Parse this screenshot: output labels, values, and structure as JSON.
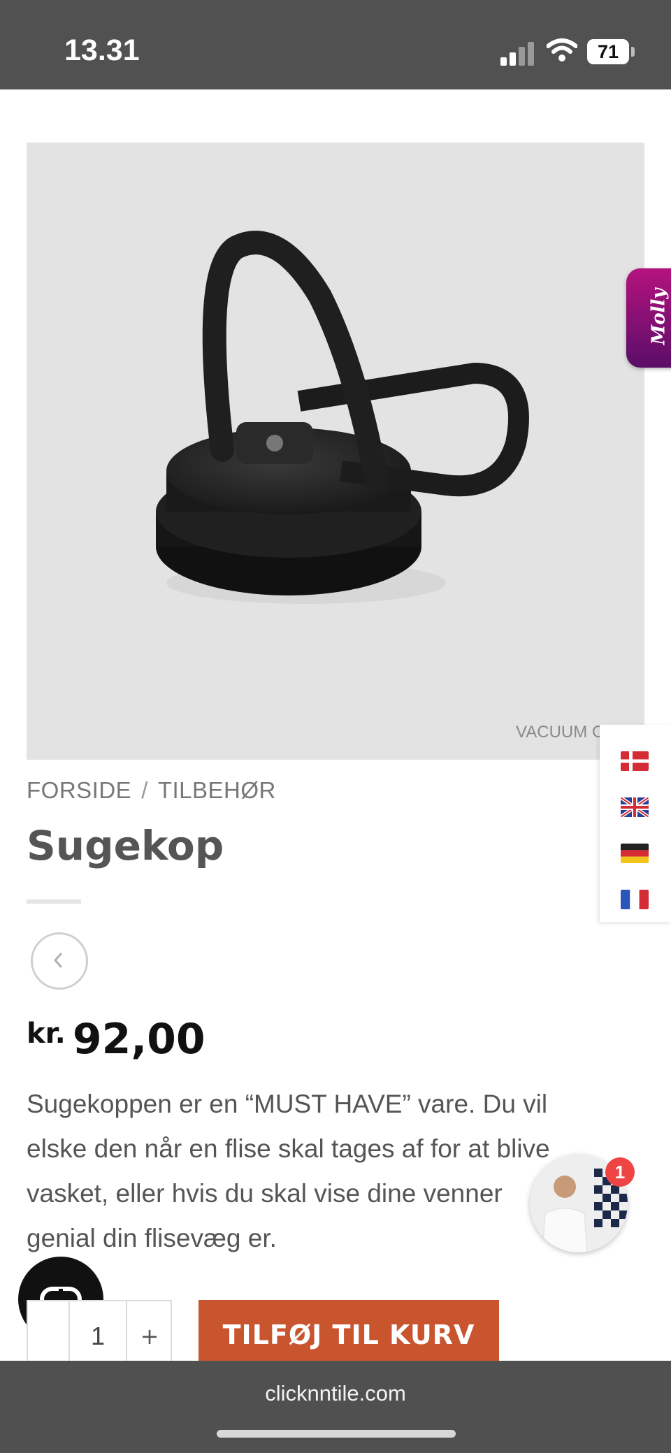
{
  "status_bar": {
    "time": "13.31",
    "battery": "71"
  },
  "product": {
    "image_caption": "VACUUM C",
    "breadcrumb": {
      "home": "FORSIDE",
      "separator": "/",
      "category": "TILBEHØR"
    },
    "title": "Sugekop",
    "price": {
      "currency": "kr.",
      "amount": "92,00"
    },
    "description_lines": [
      "Sugekoppen er en “MUST HAVE” vare. Du vil",
      "elske den når en flise skal tages af for at blive",
      "vasket, eller hvis du skal vise dine venner",
      "genial din flisevæg er."
    ]
  },
  "molly_tab": {
    "label": "Molly"
  },
  "languages": [
    "danish-flag-icon",
    "english-flag-icon",
    "german-flag-icon",
    "french-flag-icon"
  ],
  "chat": {
    "badge_count": "1"
  },
  "cart": {
    "quantity": "1",
    "plus": "+",
    "add_label": "TILFØJ TIL KURV"
  },
  "browser": {
    "url": "clicknntile.com"
  },
  "colors": {
    "accent": "#c9552f",
    "molly": "#a3127a",
    "status_bar": "#515151"
  }
}
